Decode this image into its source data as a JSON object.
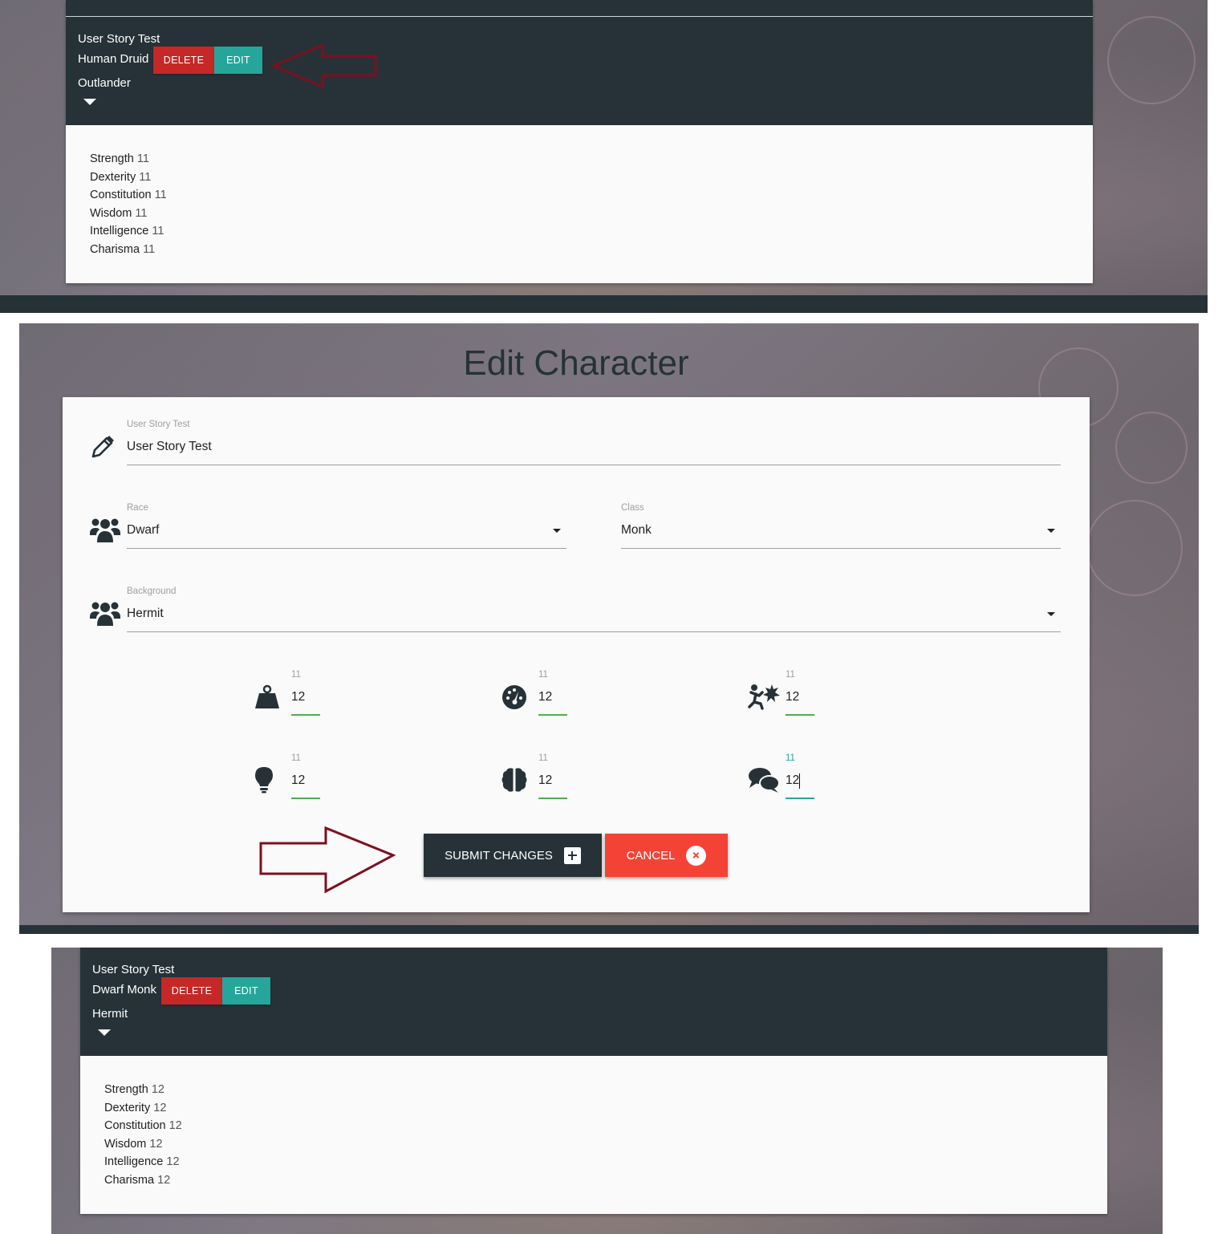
{
  "before_card": {
    "name": "User Story Test",
    "race_class": "Human Druid",
    "background": "Outlander",
    "delete_label": "DELETE",
    "edit_label": "EDIT",
    "stats": [
      {
        "label": "Strength",
        "value": "11"
      },
      {
        "label": "Dexterity",
        "value": "11"
      },
      {
        "label": "Constitution",
        "value": "11"
      },
      {
        "label": "Wisdom",
        "value": "11"
      },
      {
        "label": "Intelligence",
        "value": "11"
      },
      {
        "label": "Charisma",
        "value": "11"
      }
    ]
  },
  "edit_form": {
    "title": "Edit Character",
    "name_field": {
      "label": "User Story Test",
      "value": "User Story Test"
    },
    "race_field": {
      "label": "Race",
      "value": "Dwarf"
    },
    "class_field": {
      "label": "Class",
      "value": "Monk"
    },
    "background_field": {
      "label": "Background",
      "value": "Hermit"
    },
    "stat_fields": [
      {
        "icon": "weight-icon",
        "label": "11",
        "value": "12"
      },
      {
        "icon": "tachometer-icon",
        "label": "11",
        "value": "12"
      },
      {
        "icon": "user-injured-icon",
        "label": "11",
        "value": "12"
      },
      {
        "icon": "lightbulb-icon",
        "label": "11",
        "value": "12"
      },
      {
        "icon": "brain-icon",
        "label": "11",
        "value": "12"
      },
      {
        "icon": "comments-icon",
        "label": "11",
        "value": "12"
      }
    ],
    "submit_label": "SUBMIT CHANGES",
    "cancel_label": "CANCEL"
  },
  "after_card": {
    "name": "User Story Test",
    "race_class": "Dwarf Monk",
    "background": "Hermit",
    "delete_label": "DELETE",
    "edit_label": "EDIT",
    "stats": [
      {
        "label": "Strength",
        "value": "12"
      },
      {
        "label": "Dexterity",
        "value": "12"
      },
      {
        "label": "Constitution",
        "value": "12"
      },
      {
        "label": "Wisdom",
        "value": "12"
      },
      {
        "label": "Intelligence",
        "value": "12"
      },
      {
        "label": "Charisma",
        "value": "12"
      }
    ]
  },
  "colors": {
    "header_dark": "#263238",
    "delete_red": "#c62828",
    "edit_teal": "#26a69a",
    "cancel_red": "#f44336",
    "underline_green": "#4caf50",
    "annotation_arrow": "#7b1020"
  }
}
